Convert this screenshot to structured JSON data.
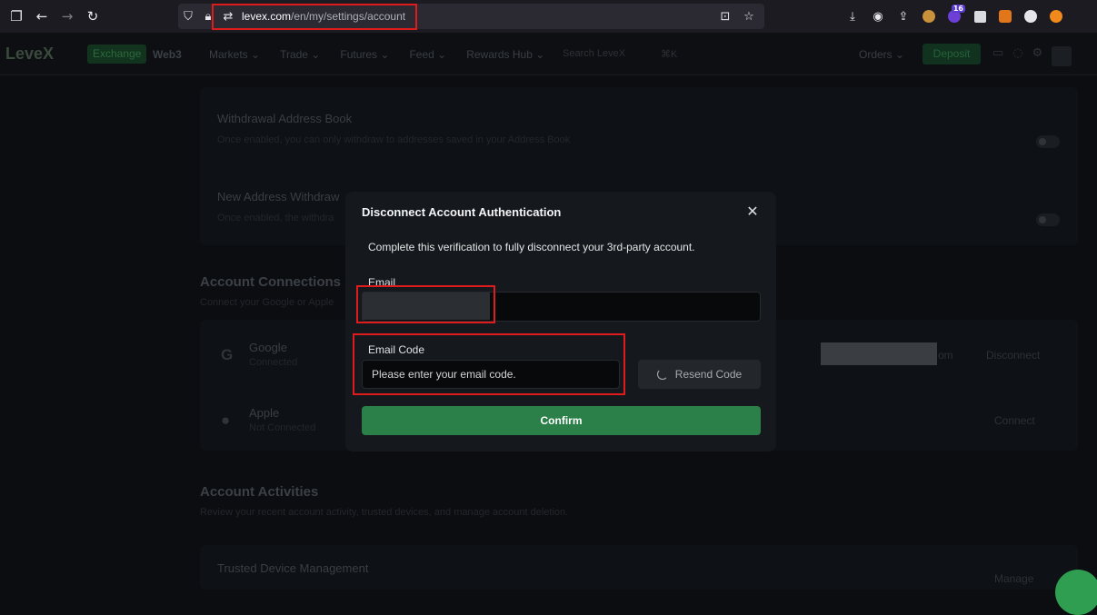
{
  "browser": {
    "url_domain": "levex.com",
    "url_path": "/en/my/settings/account",
    "badge_count": "16"
  },
  "header": {
    "logo": "LeveX",
    "exchange": "Exchange",
    "web3": "Web3",
    "menu": [
      "Markets ⌄",
      "Trade ⌄",
      "Futures ⌄",
      "Feed ⌄",
      "Rewards Hub ⌄"
    ],
    "search_placeholder": "Search LeveX",
    "search_shortcut": "⌘K",
    "orders": "Orders ⌄",
    "deposit": "Deposit"
  },
  "background": {
    "withdrawal_book_title": "Withdrawal Address Book",
    "withdrawal_book_desc": "Once enabled, you can only withdraw to addresses saved in your Address Book",
    "new_address_title": "New Address Withdraw",
    "new_address_desc": "Once enabled, the withdra",
    "connections_title": "Account Connections",
    "connections_desc": "Connect your Google or Apple",
    "google_name": "Google",
    "google_status": "Connected",
    "google_email_tail": "om",
    "google_action": "Disconnect",
    "apple_name": "Apple",
    "apple_status": "Not Connected",
    "apple_action": "Connect",
    "activities_title": "Account Activities",
    "activities_desc": "Review your recent account activity, trusted devices, and manage account deletion.",
    "trusted_title": "Trusted Device Management",
    "trusted_action": "Manage"
  },
  "modal": {
    "title": "Disconnect Account Authentication",
    "description": "Complete this verification to fully disconnect your 3rd-party account.",
    "email_label": "Email",
    "code_label": "Email Code",
    "code_placeholder": "Please enter your email code.",
    "resend_label": "Resend Code",
    "confirm_label": "Confirm"
  }
}
